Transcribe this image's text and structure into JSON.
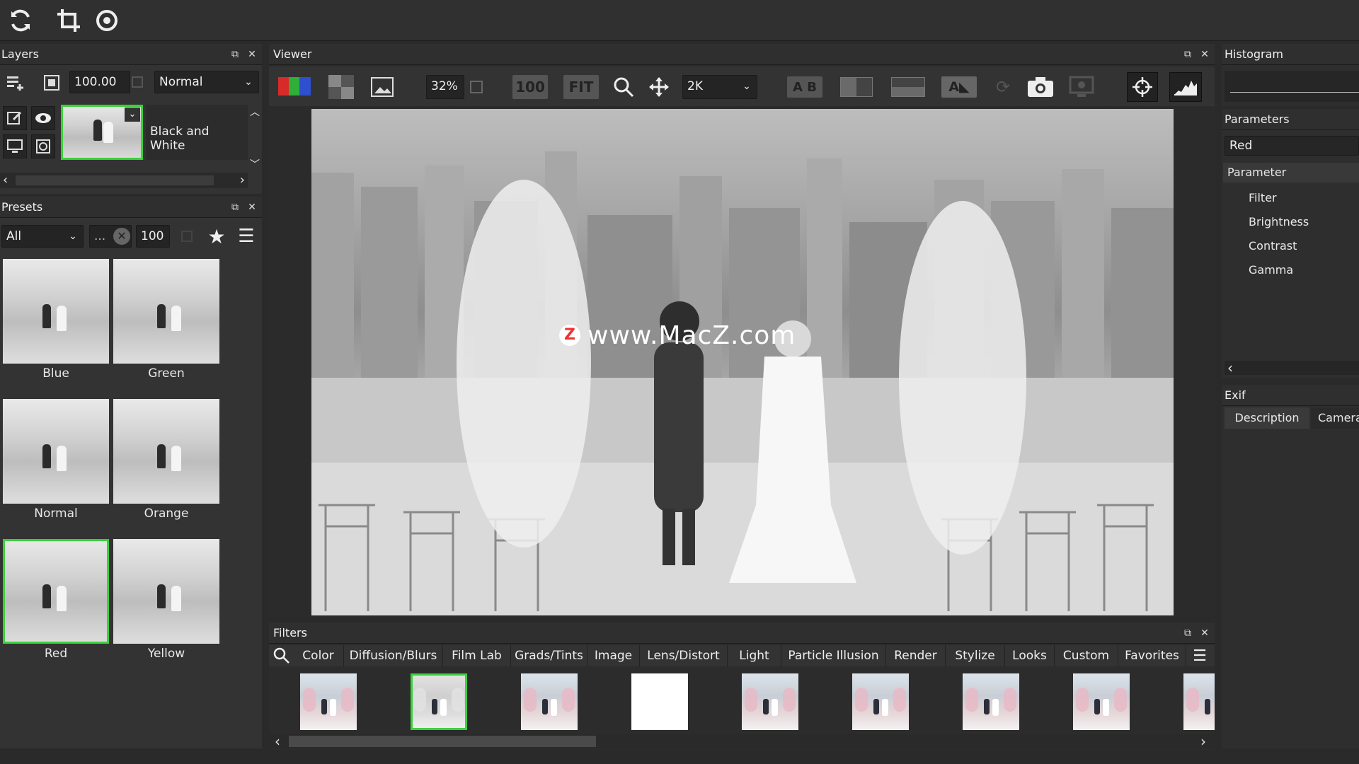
{
  "toolbar": {
    "icons": [
      "refresh-icon",
      "crop-icon",
      "rotate-icon"
    ]
  },
  "layers": {
    "title": "Layers",
    "opacity": "100.00",
    "blend_mode": "Normal",
    "layer_name": "Black and White"
  },
  "presets": {
    "title": "Presets",
    "filter": "All",
    "search": "...",
    "size": "100",
    "items": [
      {
        "label": "Blue"
      },
      {
        "label": "Green"
      },
      {
        "label": "Normal"
      },
      {
        "label": "Orange"
      },
      {
        "label": "Red"
      },
      {
        "label": "Yellow"
      }
    ],
    "selected": "Red"
  },
  "viewer": {
    "title": "Viewer",
    "zoom": "32%",
    "btn_100": "100",
    "btn_fit": "FIT",
    "resolution": "2K",
    "ab_label": "A B",
    "watermark": "www.MacZ.com",
    "watermark_logo": "Z"
  },
  "filters": {
    "title": "Filters",
    "tabs": [
      "Color",
      "Diffusion/Blurs",
      "Film Lab",
      "Grads/Tints",
      "Image",
      "Lens/Distort",
      "Light",
      "Particle Illusion",
      "Render",
      "Stylize",
      "Looks",
      "Custom",
      "Favorites"
    ]
  },
  "right": {
    "histogram_title": "Histogram",
    "parameters_title": "Parameters",
    "preset_name": "Red",
    "param_header": "Parameter",
    "params": [
      "Filter",
      "Brightness",
      "Contrast",
      "Gamma"
    ],
    "exif_title": "Exif",
    "exif_tabs": [
      "Description",
      "Camera"
    ]
  },
  "colors": {
    "accent": "#3bd13b",
    "panel": "#333333",
    "bg": "#2a2a2a"
  }
}
